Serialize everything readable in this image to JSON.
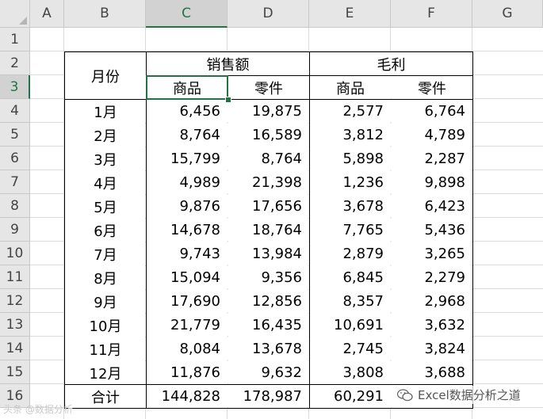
{
  "columns": [
    "A",
    "B",
    "C",
    "D",
    "E",
    "F",
    "G"
  ],
  "rows": [
    "1",
    "2",
    "3",
    "4",
    "5",
    "6",
    "7",
    "8",
    "9",
    "10",
    "11",
    "12",
    "13",
    "14",
    "15",
    "16"
  ],
  "selected": {
    "column": "C",
    "row": "3"
  },
  "table": {
    "header": {
      "month_label": "月份",
      "sales_label": "销售额",
      "profit_label": "毛利",
      "sub_goods": "商品",
      "sub_parts": "零件"
    },
    "data_rows": [
      {
        "month": "1月",
        "sales_goods": "6,456",
        "sales_parts": "19,875",
        "profit_goods": "2,577",
        "profit_parts": "6,764"
      },
      {
        "month": "2月",
        "sales_goods": "8,764",
        "sales_parts": "16,589",
        "profit_goods": "3,812",
        "profit_parts": "4,789"
      },
      {
        "month": "3月",
        "sales_goods": "15,799",
        "sales_parts": "8,764",
        "profit_goods": "5,898",
        "profit_parts": "2,287"
      },
      {
        "month": "4月",
        "sales_goods": "4,989",
        "sales_parts": "21,398",
        "profit_goods": "1,236",
        "profit_parts": "9,898"
      },
      {
        "month": "5月",
        "sales_goods": "9,876",
        "sales_parts": "17,656",
        "profit_goods": "3,678",
        "profit_parts": "6,423"
      },
      {
        "month": "6月",
        "sales_goods": "14,678",
        "sales_parts": "18,764",
        "profit_goods": "7,765",
        "profit_parts": "5,436"
      },
      {
        "month": "7月",
        "sales_goods": "9,743",
        "sales_parts": "13,984",
        "profit_goods": "2,879",
        "profit_parts": "3,265"
      },
      {
        "month": "8月",
        "sales_goods": "15,094",
        "sales_parts": "9,356",
        "profit_goods": "6,845",
        "profit_parts": "2,279"
      },
      {
        "month": "9月",
        "sales_goods": "17,690",
        "sales_parts": "12,856",
        "profit_goods": "8,357",
        "profit_parts": "2,968"
      },
      {
        "month": "10月",
        "sales_goods": "21,779",
        "sales_parts": "16,435",
        "profit_goods": "10,691",
        "profit_parts": "3,632"
      },
      {
        "month": "11月",
        "sales_goods": "8,084",
        "sales_parts": "13,678",
        "profit_goods": "2,745",
        "profit_parts": "3,824"
      },
      {
        "month": "12月",
        "sales_goods": "11,876",
        "sales_parts": "9,632",
        "profit_goods": "3,808",
        "profit_parts": "3,688"
      }
    ],
    "total_row": {
      "month": "合计",
      "sales_goods": "144,828",
      "sales_parts": "178,987",
      "profit_goods": "60,291",
      "profit_parts": ""
    }
  },
  "watermark": {
    "text": "Excel数据分析之道",
    "left_text": "头条 @数据分析",
    "icon": "wechat-icon"
  },
  "colors": {
    "accent": "#217346",
    "header_bg": "#e6e6e6",
    "grid": "#dadada"
  }
}
